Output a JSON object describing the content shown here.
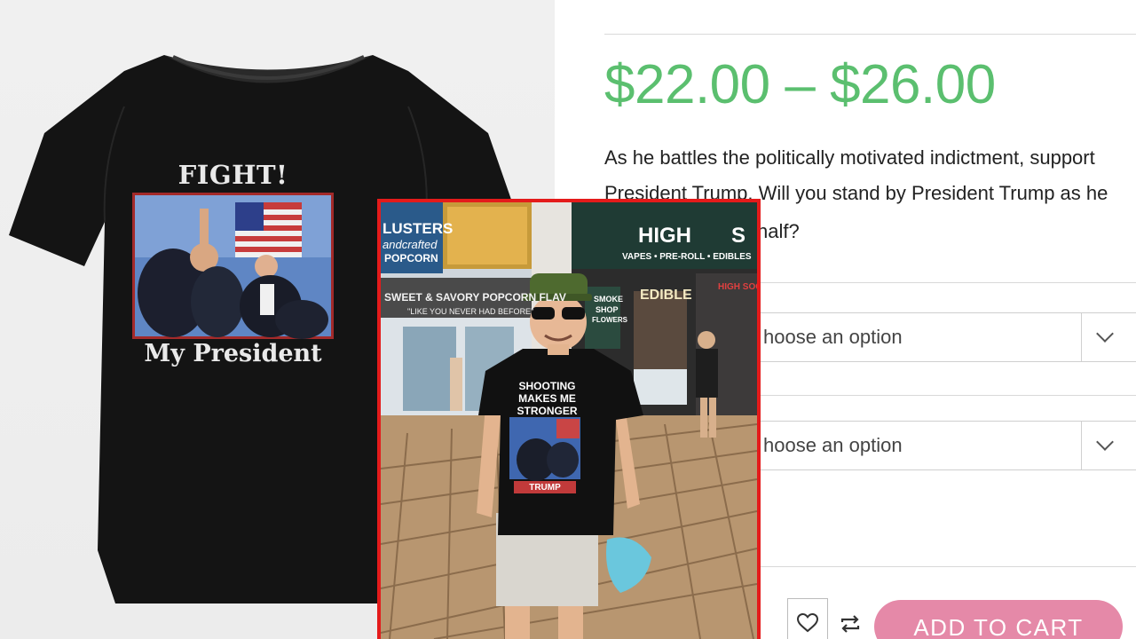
{
  "shirt_panel": {
    "heading": "FIGHT!",
    "subheading": "My President"
  },
  "product": {
    "price": "$22.00 – $26.00",
    "description_lines": [
      "As he battles the politically motivated indictment, support",
      "President Trump. Will you stand by President Trump as he",
      "half?"
    ],
    "option_1": "hoose an option",
    "option_2": "hoose an option",
    "add_to_cart": "ADD TO CART",
    "price_color": "#5bbf6f",
    "button_color": "#e589a8"
  },
  "photo": {
    "frame_color": "#e41b1b",
    "signs": {
      "clusters": "LUSTERS",
      "handcrafted": "andcrafted",
      "popcorn": "POPCORN",
      "banner": "SWEET & SAVORY POPCORN FLAV",
      "tagline": "\"LIKE YOU NEVER HAD BEFORE\"",
      "high_logo": "HIGH",
      "high_logo_tail": "S",
      "high_products": "VAPES • PRE-ROLL • EDIBLES",
      "edible_sign": "EDIBLE",
      "smoke_sign_1": "SMOKE",
      "smoke_sign_2": "SHOP",
      "smoke_sign_3": "FLOWERS",
      "high_socks": "HIGH SOC"
    },
    "tshirt": {
      "line1": "SHOOTING",
      "line2": "MAKES ME",
      "line3": "STRONGER",
      "brand": "TRUMP"
    }
  },
  "icons": [
    "heart-icon",
    "compare-arrows-icon",
    "chevron-down-icon"
  ]
}
